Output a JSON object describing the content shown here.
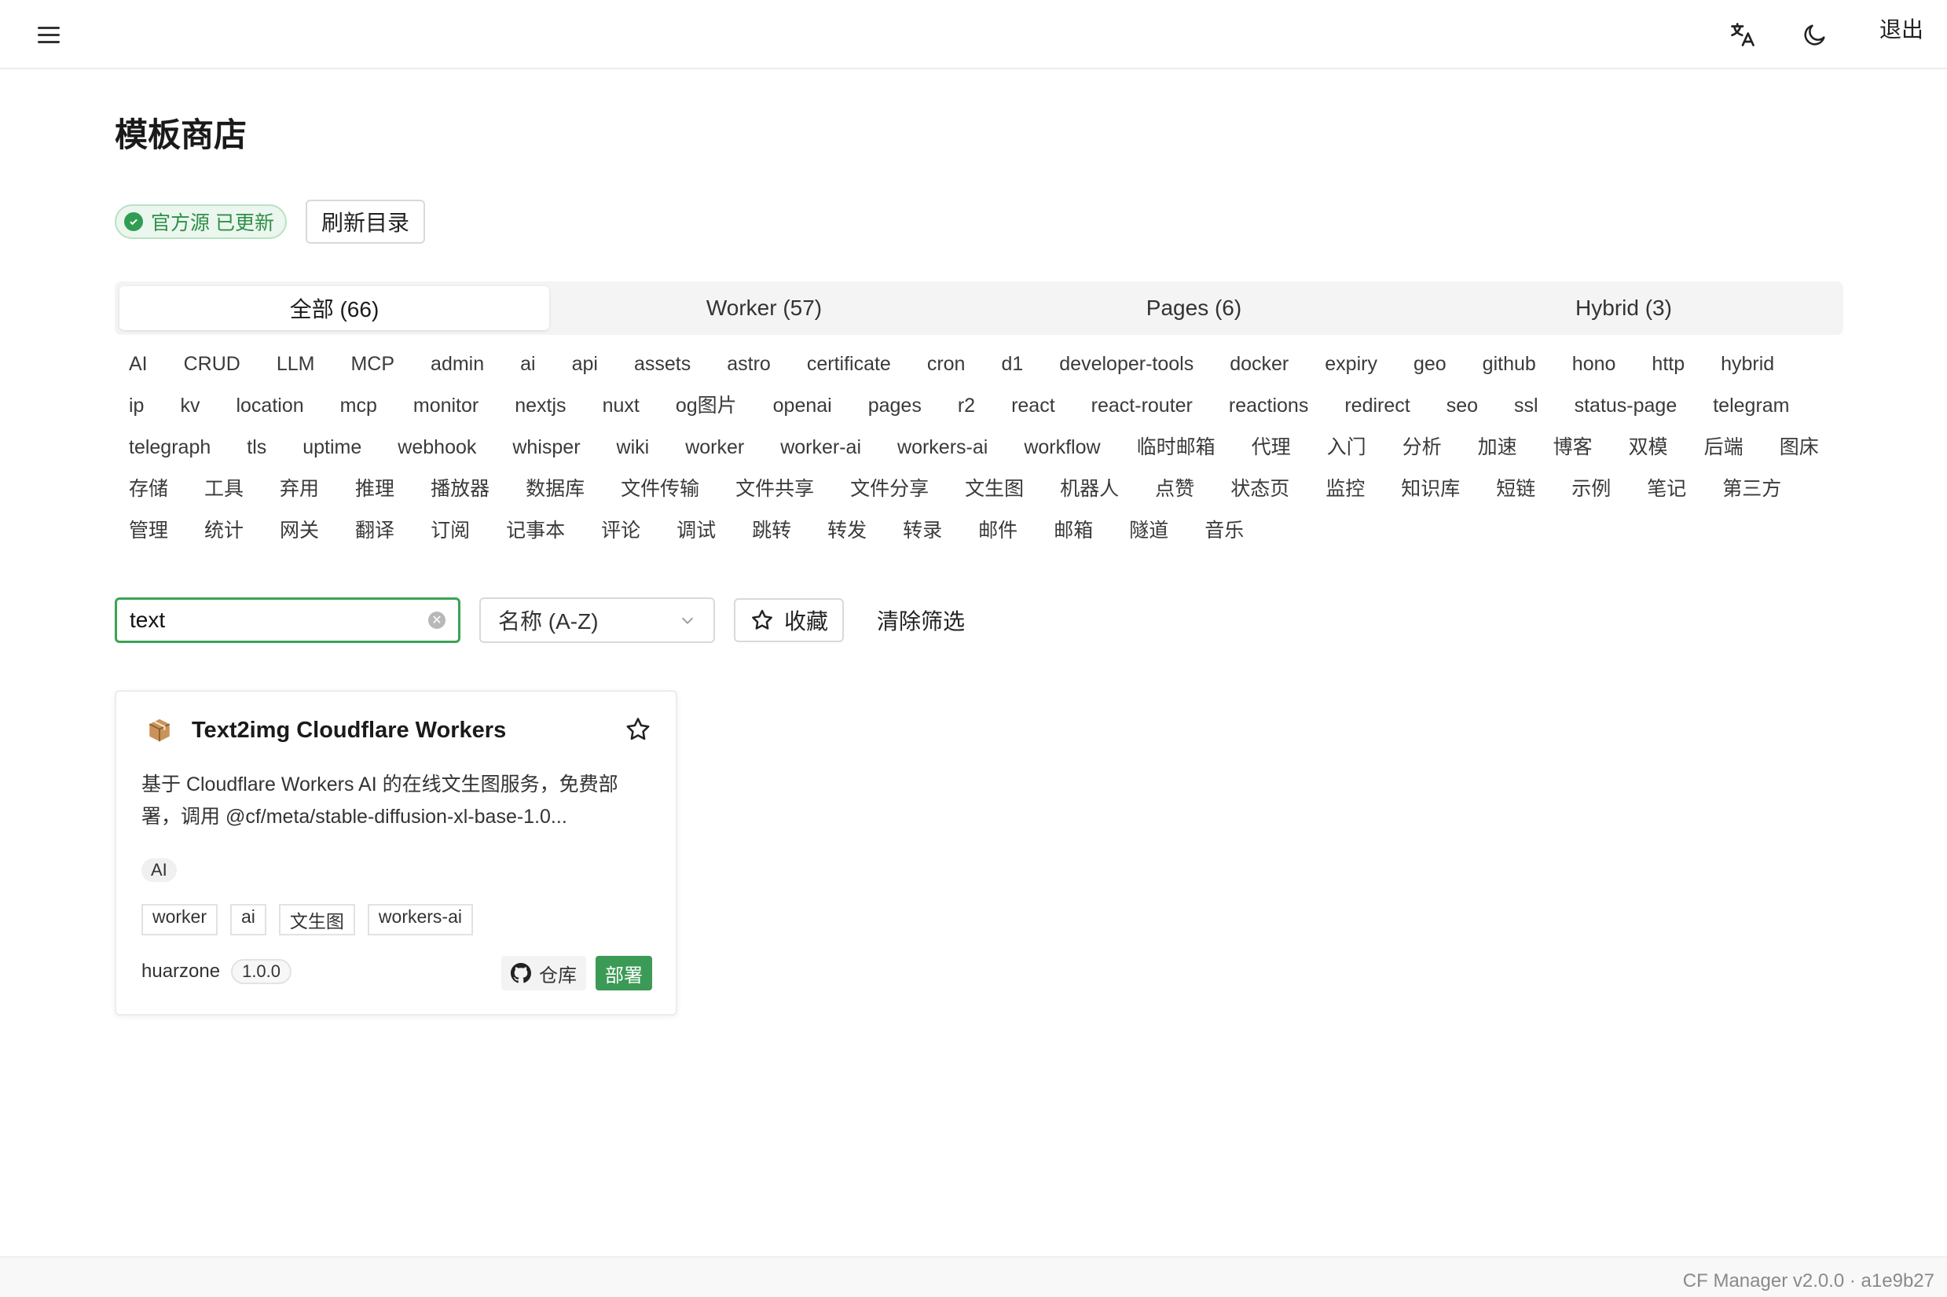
{
  "header": {
    "menu_icon": "hamburger-menu-icon",
    "translate_icon": "translate-icon",
    "theme_icon": "moon-icon",
    "logout_label": "退出"
  },
  "page_title": "模板商店",
  "status": {
    "badge_label": "官方源 已更新",
    "badge_color": "#2f8f48",
    "refresh_label": "刷新目录"
  },
  "tabs": [
    {
      "label": "全部 (66)",
      "active": true
    },
    {
      "label": "Worker (57)",
      "active": false
    },
    {
      "label": "Pages (6)",
      "active": false
    },
    {
      "label": "Hybrid (3)",
      "active": false
    }
  ],
  "tags": [
    "AI",
    "CRUD",
    "LLM",
    "MCP",
    "admin",
    "ai",
    "api",
    "assets",
    "astro",
    "certificate",
    "cron",
    "d1",
    "developer-tools",
    "docker",
    "expiry",
    "geo",
    "github",
    "hono",
    "http",
    "hybrid",
    "ip",
    "kv",
    "location",
    "mcp",
    "monitor",
    "nextjs",
    "nuxt",
    "og图片",
    "openai",
    "pages",
    "r2",
    "react",
    "react-router",
    "reactions",
    "redirect",
    "seo",
    "ssl",
    "status-page",
    "telegram",
    "telegraph",
    "tls",
    "uptime",
    "webhook",
    "whisper",
    "wiki",
    "worker",
    "worker-ai",
    "workers-ai",
    "workflow",
    "临时邮箱",
    "代理",
    "入门",
    "分析",
    "加速",
    "博客",
    "双模",
    "后端",
    "图床",
    "存储",
    "工具",
    "弃用",
    "推理",
    "播放器",
    "数据库",
    "文件传输",
    "文件共享",
    "文件分享",
    "文生图",
    "机器人",
    "点赞",
    "状态页",
    "监控",
    "知识库",
    "短链",
    "示例",
    "笔记",
    "第三方",
    "管理",
    "统计",
    "网关",
    "翻译",
    "订阅",
    "记事本",
    "评论",
    "调试",
    "跳转",
    "转发",
    "转录",
    "邮件",
    "邮箱",
    "隧道",
    "音乐"
  ],
  "filters": {
    "search_value": "text",
    "sort_selected": "名称 (A-Z)",
    "favorites_label": "收藏",
    "clear_label": "清除筛选"
  },
  "cards": [
    {
      "icon": "package-icon",
      "title": "Text2img Cloudflare Workers",
      "description": "基于 Cloudflare Workers AI 的在线文生图服务，免费部署，调用 @cf/meta/stable-diffusion-xl-base-1.0...",
      "category": "AI",
      "tags": [
        "worker",
        "ai",
        "文生图",
        "workers-ai"
      ],
      "author": "huarzone",
      "version": "1.0.0",
      "repo_label": "仓库",
      "deploy_label": "部署"
    }
  ],
  "footer": {
    "text": "CF Manager v2.0.0 · a1e9b27"
  },
  "colors": {
    "accent": "#3b9a56",
    "focus_border": "#3ca353"
  }
}
